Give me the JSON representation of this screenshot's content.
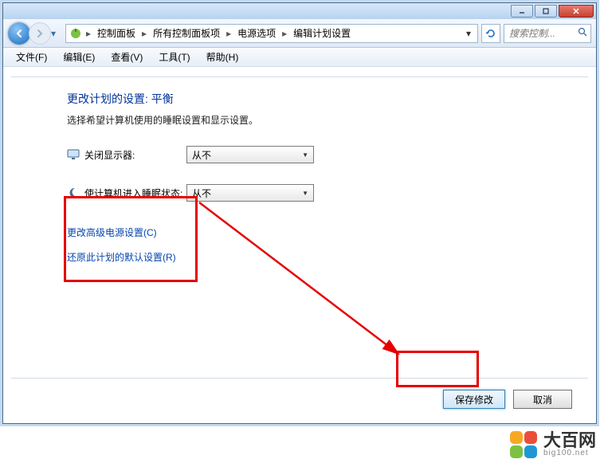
{
  "titlebar": {},
  "breadcrumb": {
    "items": [
      "控制面板",
      "所有控制面板项",
      "电源选项",
      "编辑计划设置"
    ]
  },
  "search": {
    "placeholder": "搜索控制..."
  },
  "menu": {
    "file": "文件(F)",
    "edit": "编辑(E)",
    "view": "查看(V)",
    "tools": "工具(T)",
    "help": "帮助(H)"
  },
  "page": {
    "title": "更改计划的设置: 平衡",
    "subtitle": "选择希望计算机使用的睡眠设置和显示设置。"
  },
  "settings": {
    "display_off": {
      "label": "关闭显示器:",
      "value": "从不"
    },
    "sleep": {
      "label": "使计算机进入睡眠状态:",
      "value": "从不"
    }
  },
  "links": {
    "advanced": "更改高级电源设置(C)",
    "restore": "还原此计划的默认设置(R)"
  },
  "buttons": {
    "save": "保存修改",
    "cancel": "取消"
  },
  "watermark": {
    "name": "大百网",
    "url": "big100.net",
    "colors": [
      "#f7a823",
      "#e94e3b",
      "#7cc142",
      "#1f97d4"
    ]
  }
}
